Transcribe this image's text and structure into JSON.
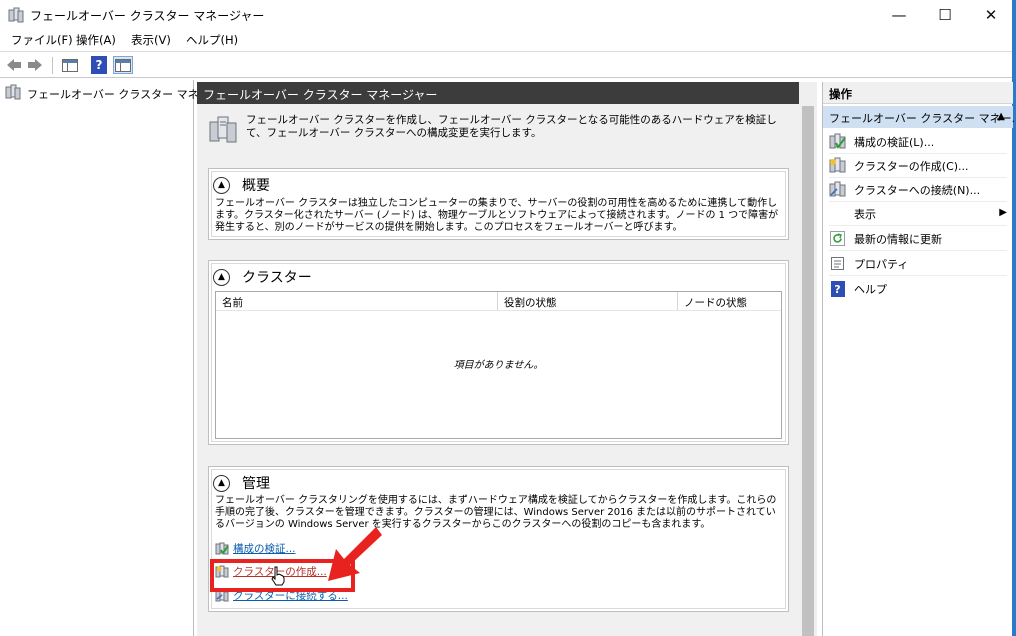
{
  "window": {
    "title": "フェールオーバー クラスター マネージャー",
    "min_glyph": "—",
    "max_glyph": "☐",
    "close_glyph": "✕"
  },
  "menu": [
    "ファイル(F)",
    "操作(A)",
    "表示(V)",
    "ヘルプ(H)"
  ],
  "tree": {
    "root_label": "フェールオーバー クラスター マネージャ"
  },
  "center": {
    "header": "フェールオーバー クラスター マネージャー",
    "intro": "フェールオーバー クラスターを作成し、フェールオーバー クラスターとなる可能性のあるハードウェアを検証して、フェールオーバー クラスターへの構成変更を実行します。",
    "overview": {
      "title": "概要",
      "text": "フェールオーバー クラスターは独立したコンピューターの集まりで、サーバーの役割の可用性を高めるために連携して動作します。クラスター化されたサーバー (ノード) は、物理ケーブルとソフトウェアによって接続されます。ノードの 1 つで障害が発生すると、別のノードがサービスの提供を開始します。このプロセスをフェールオーバーと呼びます。"
    },
    "clusters": {
      "title": "クラスター",
      "columns": [
        "名前",
        "役割の状態",
        "ノードの状態"
      ],
      "empty_message": "項目がありません。"
    },
    "management": {
      "title": "管理",
      "text": "フェールオーバー クラスタリングを使用するには、まずハードウェア構成を検証してからクラスターを作成します。これらの手順の完了後、クラスターを管理できます。クラスターの管理には、Windows Server 2016 または以前のサポートされているバージョンの Windows Server を実行するクラスターからこのクラスターへの役割のコピーも含まれます。",
      "links": [
        "構成の検証...",
        "クラスターの作成...",
        "クラスターに接続する..."
      ]
    }
  },
  "actions": {
    "header": "操作",
    "subheader": "フェールオーバー クラスター マネー...",
    "items": [
      {
        "label": "構成の検証(L)...",
        "icon": "validate-icon"
      },
      {
        "label": "クラスターの作成(C)...",
        "icon": "create-cluster-icon"
      },
      {
        "label": "クラスターへの接続(N)...",
        "icon": "connect-icon"
      },
      {
        "label": "表示",
        "icon": "none"
      },
      {
        "label": "最新の情報に更新",
        "icon": "refresh-icon"
      },
      {
        "label": "プロパティ",
        "icon": "properties-icon"
      },
      {
        "label": "ヘルプ",
        "icon": "help-icon"
      }
    ]
  },
  "colors": {
    "accent_blue": "#2b79c9",
    "header_dark": "#3c3c3c",
    "selection": "#cfe0f2",
    "highlight_red": "#e8231f",
    "link_blue": "#0b5cad"
  }
}
